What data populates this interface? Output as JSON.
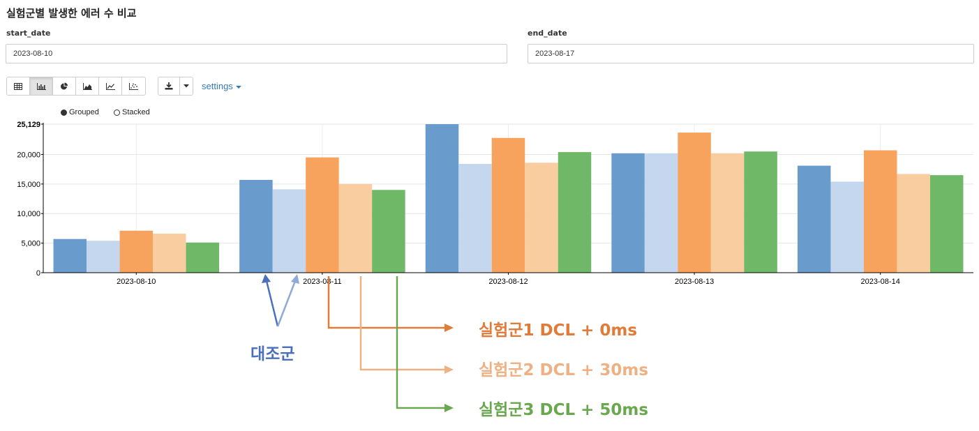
{
  "page_title": "실험군별 발생한 에러 수 비교",
  "filters": {
    "start_label": "start_date",
    "start_value": "2023-08-10",
    "end_label": "end_date",
    "end_value": "2023-08-17"
  },
  "toolbar": {
    "chart_types": [
      "table-icon",
      "bar-chart-icon",
      "pie-chart-icon",
      "area-chart-icon",
      "line-chart-icon",
      "scatter-chart-icon"
    ],
    "active": "bar-chart-icon",
    "settings_label": "settings"
  },
  "legend": {
    "options": [
      {
        "label": "Grouped",
        "selected": true
      },
      {
        "label": "Stacked",
        "selected": false
      }
    ]
  },
  "chart_data": {
    "type": "bar",
    "categories": [
      "2023-08-10",
      "2023-08-11",
      "2023-08-12",
      "2023-08-13",
      "2023-08-14"
    ],
    "series": [
      {
        "values": [
          5700,
          15700,
          25129,
          20200,
          18100
        ],
        "color": "#6699cc"
      },
      {
        "values": [
          5400,
          14100,
          18400,
          20200,
          15400
        ],
        "color": "#c4d5ef"
      },
      {
        "values": [
          7100,
          19500,
          22800,
          23700,
          20700
        ],
        "color": "#f7a05a"
      },
      {
        "values": [
          6600,
          15000,
          18600,
          20200,
          16700
        ],
        "color": "#f9cc9e"
      },
      {
        "values": [
          5100,
          14000,
          20400,
          20500,
          16500
        ],
        "color": "#6cb765"
      }
    ],
    "yticks": [
      "0",
      "5,000",
      "10,000",
      "15,000",
      "20,000",
      "25,129"
    ],
    "ylim": [
      0,
      25129
    ],
    "grid": true
  },
  "annotations": {
    "control": {
      "label": "대조군",
      "color": "#4a6fbd"
    },
    "exp1": {
      "label": "실험군1 DCL + 0ms",
      "color": "#e07b3a"
    },
    "exp2": {
      "label": "실험군2 DCL + 30ms",
      "color": "#efb083"
    },
    "exp3": {
      "label": "실험군3 DCL + 50ms",
      "color": "#6aa84f"
    }
  }
}
